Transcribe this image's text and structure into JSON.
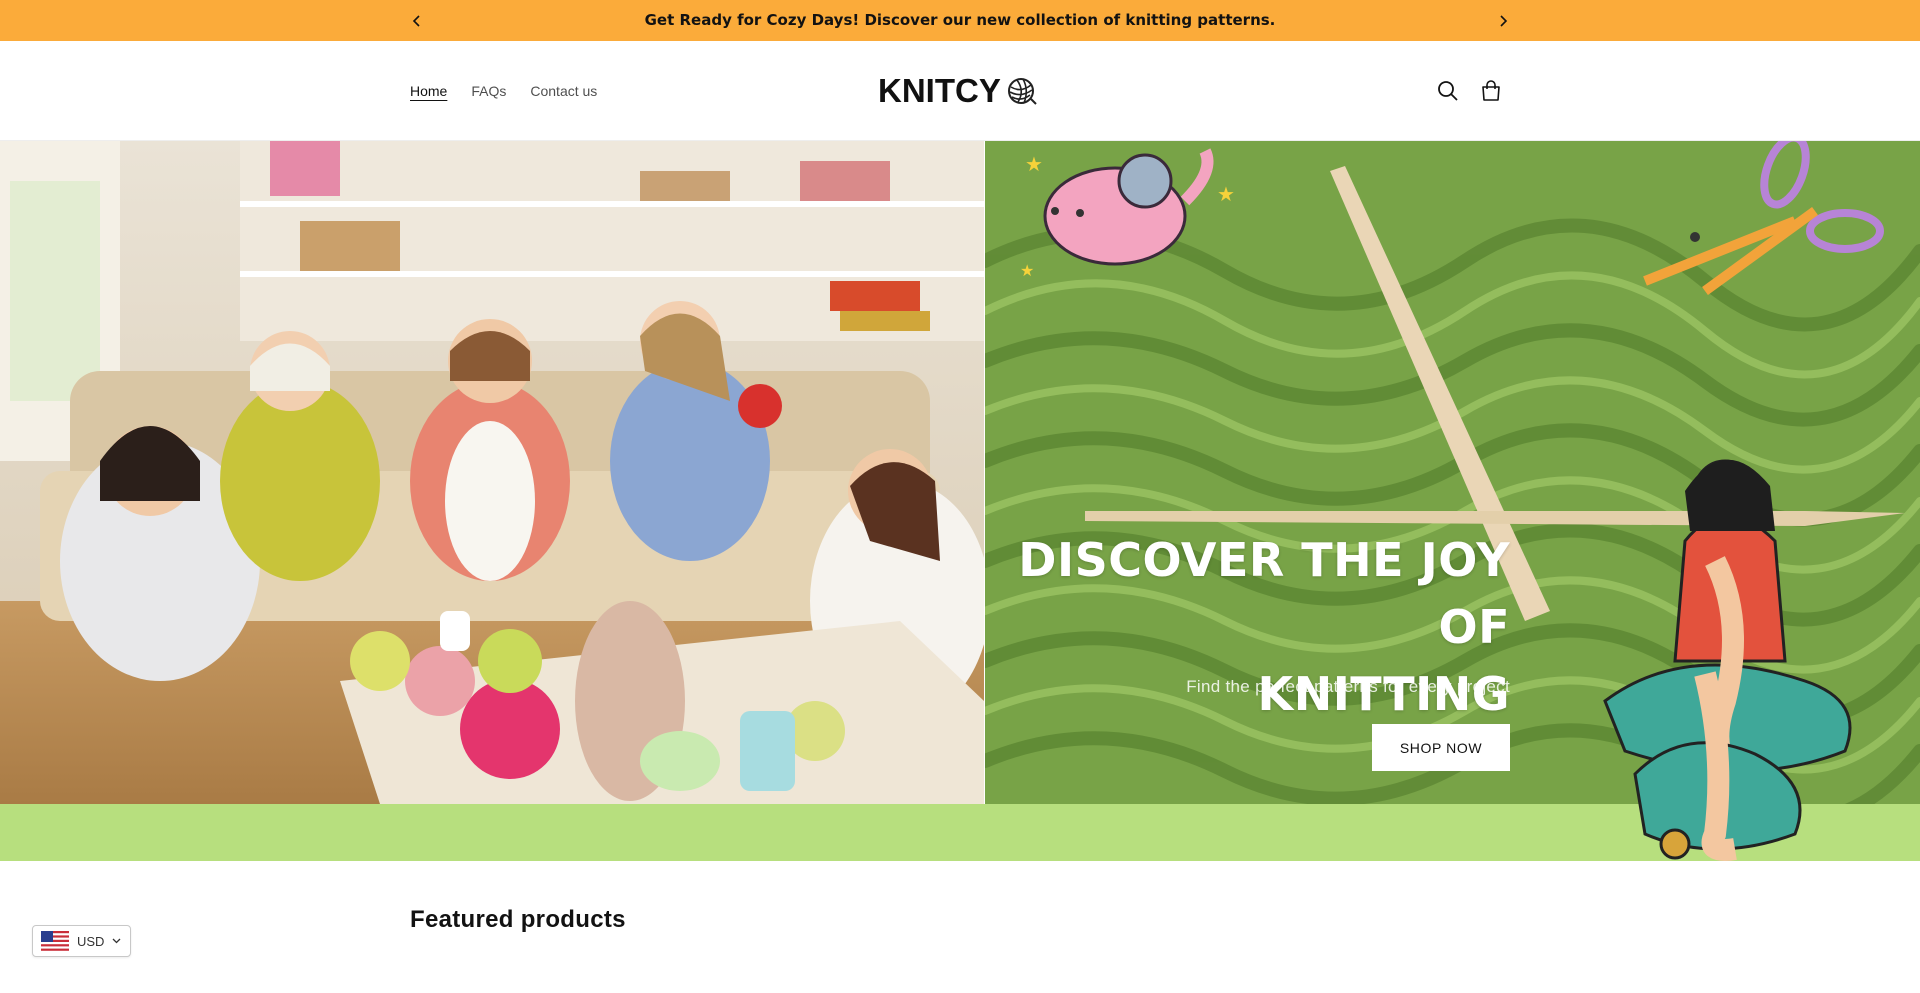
{
  "announcement": {
    "text": "Get Ready for Cozy Days! Discover our new collection of knitting patterns.",
    "background": "#fbab3a"
  },
  "nav": {
    "items": [
      {
        "label": "Home",
        "active": true
      },
      {
        "label": "FAQs",
        "active": false
      },
      {
        "label": "Contact us",
        "active": false
      }
    ]
  },
  "logo": {
    "text": "KNITCY",
    "icon": "yarn-ball-icon"
  },
  "header_icons": {
    "search": "search-icon",
    "cart": "cart-icon"
  },
  "hero": {
    "heading_line1": "DISCOVER THE JOY OF",
    "heading_line2": "KNITTING",
    "subheading": "Find the perfect patterns for every project",
    "button_label": "SHOP NOW",
    "left_image": "women-knitting-photo",
    "right_image": "green-yarn-needles-photo",
    "band_color": "#b7df7e"
  },
  "featured": {
    "title": "Featured products"
  },
  "currency": {
    "code": "USD",
    "flag": "us-flag-icon"
  }
}
